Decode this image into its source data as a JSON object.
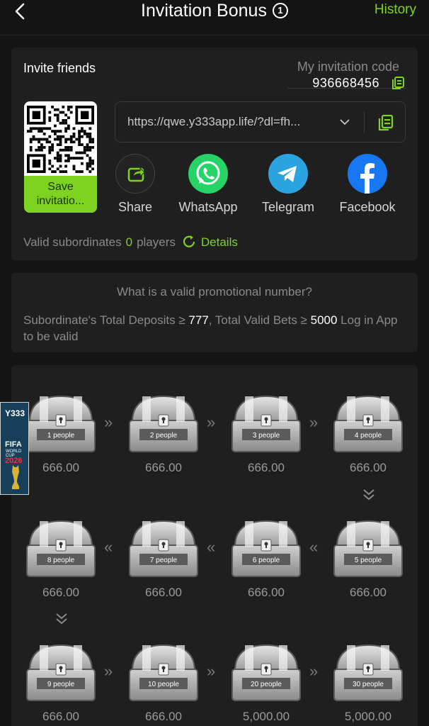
{
  "header": {
    "title": "Invitation Bonus",
    "info_glyph": "1",
    "history_label": "History"
  },
  "invite": {
    "title": "Invite friends",
    "code_label": "My invitation code",
    "code_value": "936668456",
    "save_label": "Save invitatio...",
    "link": "https://qwe.y333app.life/?dl=fh...",
    "share_items": [
      {
        "label": "Share",
        "icon": "share-icon",
        "color": "#2b2b2b"
      },
      {
        "label": "WhatsApp",
        "icon": "whatsapp-icon",
        "color": "#25d366"
      },
      {
        "label": "Telegram",
        "icon": "telegram-icon",
        "color": "#2aa3df"
      },
      {
        "label": "Facebook",
        "icon": "facebook-icon",
        "color": "#1877f2"
      }
    ],
    "valid_label": "Valid subordinates",
    "valid_count": "0",
    "valid_unit": "players",
    "details_label": "Details"
  },
  "rules": {
    "question": "What is a valid promotional number?",
    "text_a": "Subordinate's Total Deposits ≥ ",
    "deposit_value": "777",
    "text_b": ",  Total Valid Bets ≥ ",
    "bets_value": "5000",
    "text_c": " Log in App to be valid"
  },
  "chests": [
    {
      "label": "1 people",
      "amount": "666.00"
    },
    {
      "label": "2 people",
      "amount": "666.00"
    },
    {
      "label": "3 people",
      "amount": "666.00"
    },
    {
      "label": "4 people",
      "amount": "666.00"
    },
    {
      "label": "8 people",
      "amount": "666.00"
    },
    {
      "label": "7 people",
      "amount": "666.00"
    },
    {
      "label": "6 people",
      "amount": "666.00"
    },
    {
      "label": "5 people",
      "amount": "666.00"
    },
    {
      "label": "9 people",
      "amount": "666.00"
    },
    {
      "label": "10 people",
      "amount": "666.00"
    },
    {
      "label": "20 people",
      "amount": "5,000.00"
    },
    {
      "label": "30 people",
      "amount": "5,000.00"
    }
  ],
  "side_ad": {
    "brand": "Y333",
    "event": "FIFA",
    "event_sub": "WORLD CUP",
    "year": "2026"
  },
  "colors": {
    "accent": "#7ed321",
    "background": "#141414",
    "card": "#1f1f1f"
  }
}
